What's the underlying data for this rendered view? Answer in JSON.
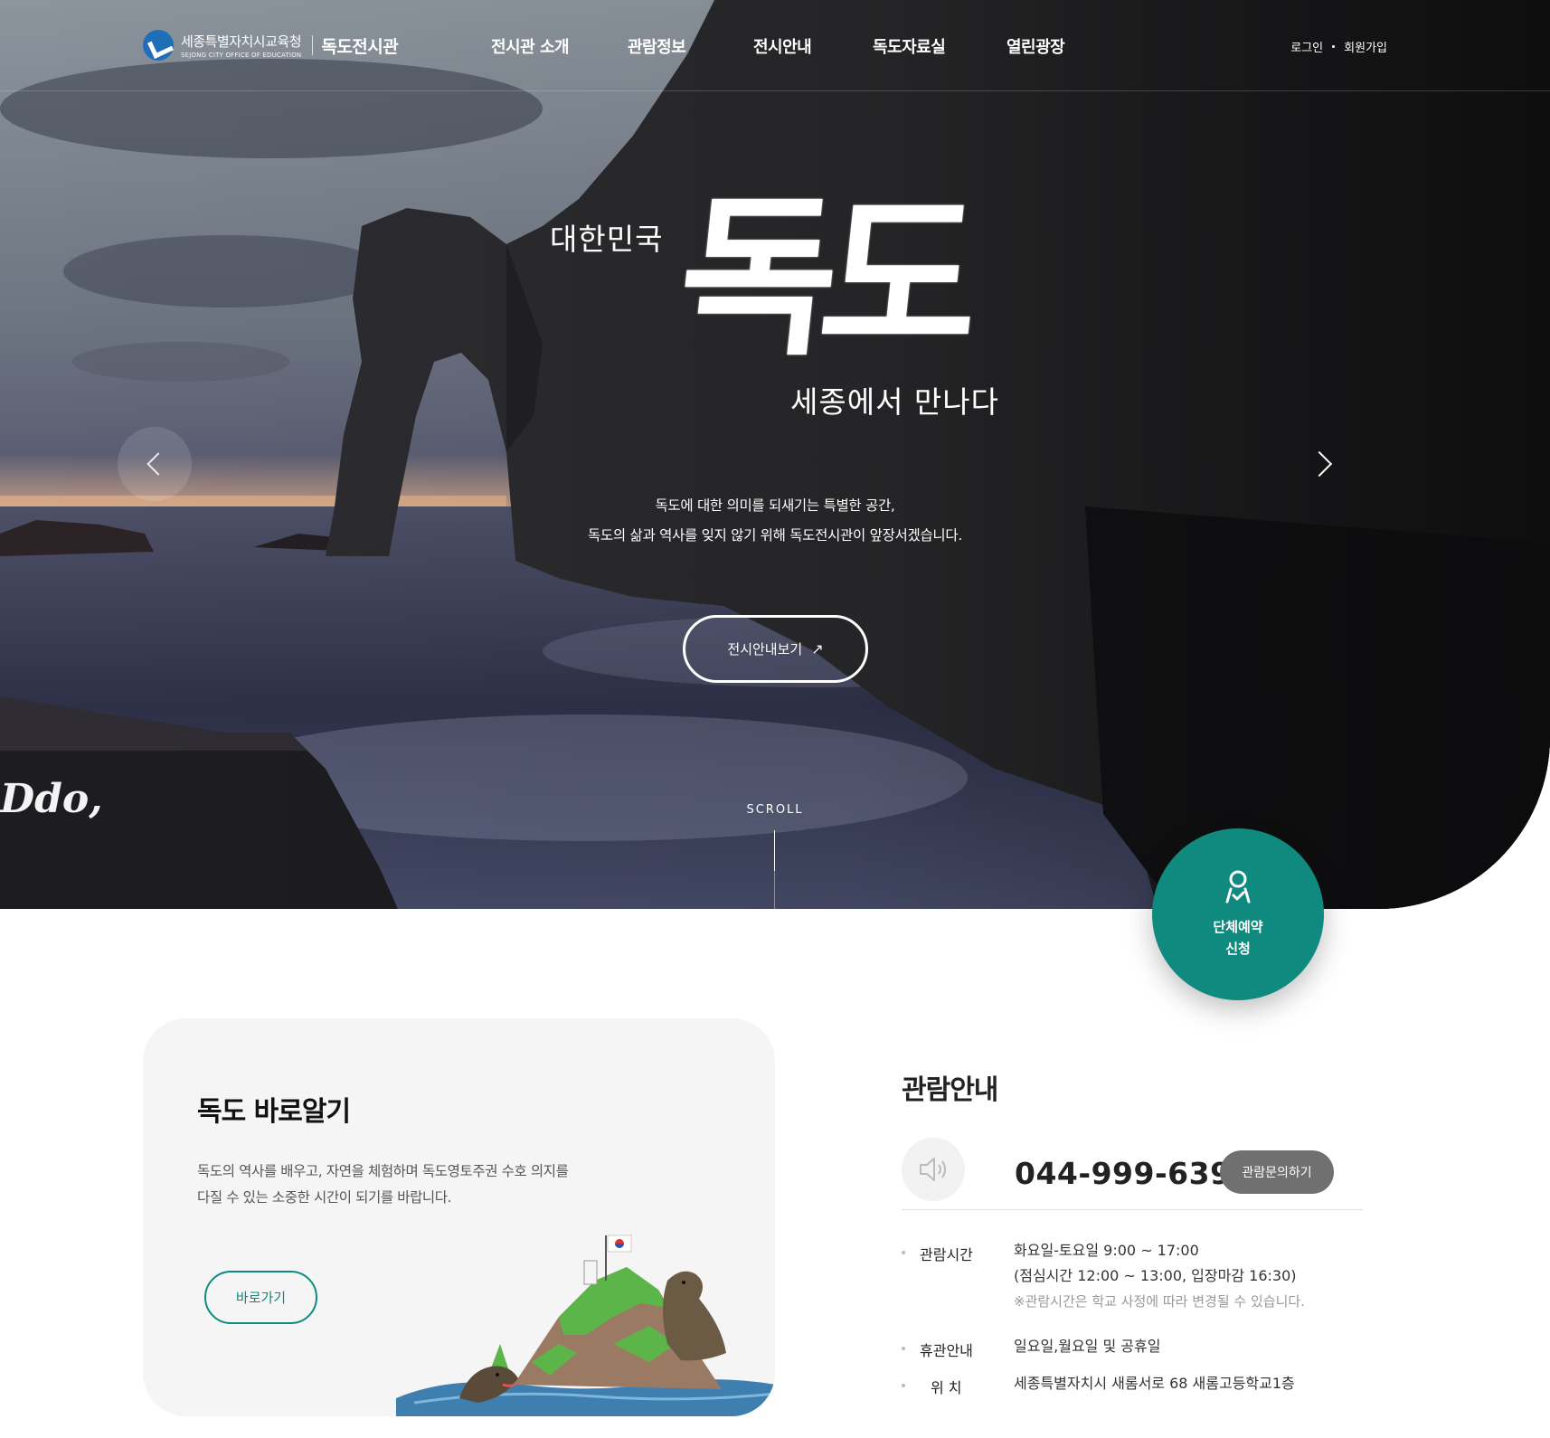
{
  "header": {
    "logo_org_ko": "세종특별자치시교육청",
    "logo_org_en": "SEJONG CITY OFFICE OF EDUCATION",
    "site_name": "독도전시관",
    "nav": [
      "전시관 소개",
      "관람정보",
      "전시안내",
      "독도자료실",
      "열린광장"
    ],
    "login": "로그인",
    "signup": "회원가입"
  },
  "hero": {
    "line1": "대한민국",
    "title": "독도",
    "line2": "세종에서 만나다",
    "desc_line1": "독도에 대한 의미를 되새기는 특별한 공간,",
    "desc_line2": "독도의 삶과 역사를 잊지 않기 위해 독도전시관이 앞장서겠습니다.",
    "button": "전시안내보기",
    "scroll": "SCROLL",
    "corner_script": "Ddo,"
  },
  "fab": {
    "line1": "단체예약",
    "line2": "신청",
    "icon": "person-check-icon"
  },
  "card": {
    "title": "독도 바로알기",
    "desc": "독도의 역사를 배우고, 자연을 체험하며 독도영토주권 수호 의지를 다질 수 있는 소중한 시간이 되기를 바랍니다.",
    "button": "바로가기"
  },
  "info": {
    "title": "관람안내",
    "phone": "044-999-6393",
    "inquiry_button": "관람문의하기",
    "hours_label": "관람시간",
    "hours_line1": "화요일-토요일 9:00 ~ 17:00",
    "hours_line2": "(점심시간 12:00 ~ 13:00, 입장마감 16:30)",
    "hours_note": "※관람시간은 학교 사정에 따라 변경될 수 있습니다.",
    "closed_label": "휴관안내",
    "closed_value": "일요일,월요일 및 공휴일",
    "location_label": "위 치",
    "location_value": "세종특별자치시 새롬서로 68 새롬고등학교1층"
  },
  "colors": {
    "accent": "#108a7f",
    "inquiry_button": "#707070",
    "card_bg": "#f5f5f5"
  }
}
